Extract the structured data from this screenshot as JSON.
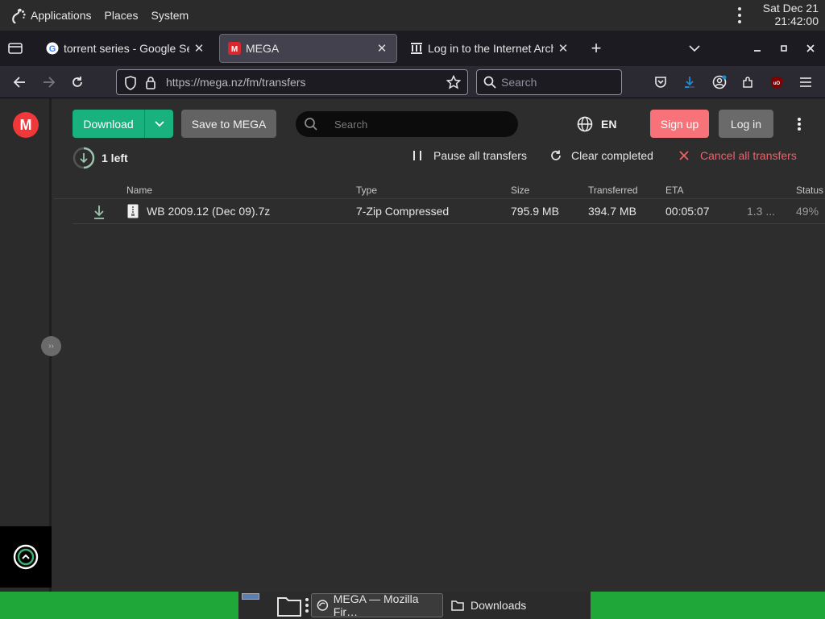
{
  "top_panel": {
    "applications": "Applications",
    "places": "Places",
    "system": "System",
    "clock_date": "Sat Dec 21",
    "clock_time": "21:42:00"
  },
  "tabs": [
    {
      "title": "torrent series - Google Search",
      "favicon": "google-icon"
    },
    {
      "title": "MEGA",
      "favicon": "mega-icon"
    },
    {
      "title": "Log in to the Internet Archive",
      "favicon": "archive-icon"
    }
  ],
  "navbar": {
    "url": "https://mega.nz/fm/transfers",
    "search_placeholder": "Search"
  },
  "mega": {
    "logo": "M",
    "download_label": "Download",
    "save_label": "Save to MEGA",
    "search_placeholder": "Search",
    "language": "EN",
    "signup_label": "Sign up",
    "login_label": "Log in",
    "transfers_left": "1 left",
    "pause_all": "Pause all transfers",
    "clear_completed": "Clear completed",
    "cancel_all": "Cancel all transfers",
    "columns": [
      "Name",
      "Type",
      "Size",
      "Transferred",
      "ETA",
      "Status"
    ],
    "transfer": {
      "name": "WB 2009.12 (Dec 09).7z",
      "type": "7-Zip Compressed",
      "size": "795.9 MB",
      "transferred": "394.7 MB",
      "eta": "00:05:07",
      "speed": "1.3 ...",
      "status": "49%"
    }
  },
  "taskbar": {
    "firefox": "MEGA — Mozilla Fir…",
    "downloads": "Downloads"
  },
  "colors": {
    "mega_red": "#f0373a",
    "download_green": "#19b17e",
    "signup_pink": "#f8727a",
    "cancel_red": "#f0616a",
    "taskbar_green": "#20a73a"
  }
}
